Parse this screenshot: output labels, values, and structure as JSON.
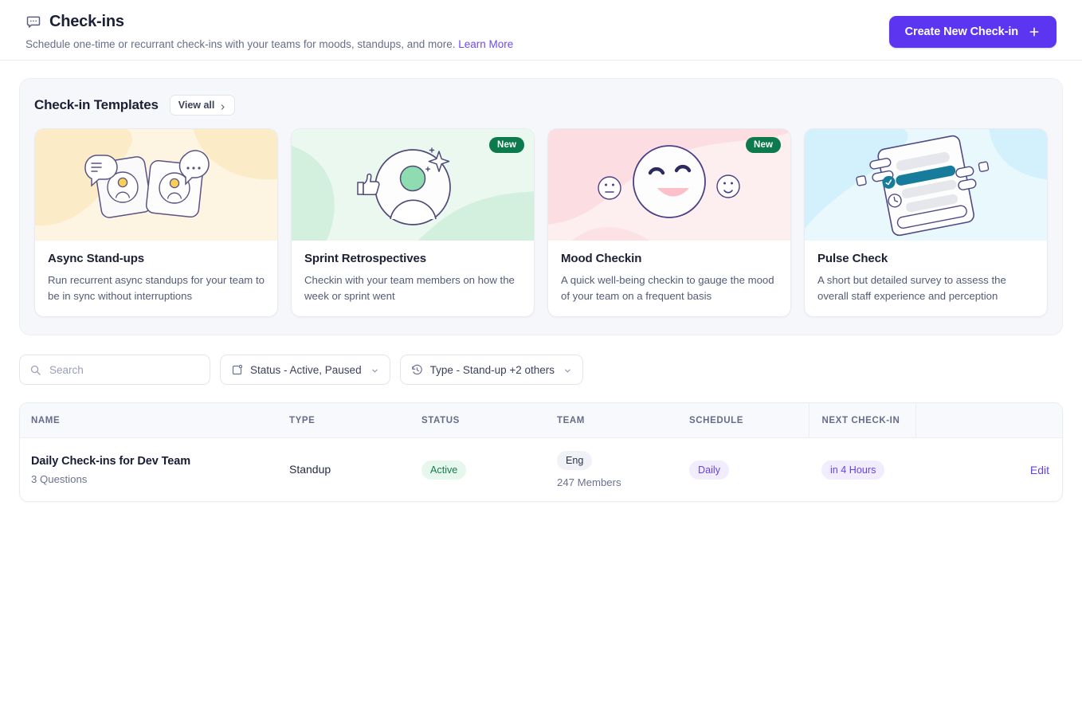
{
  "header": {
    "icon": "message-square-dots-icon",
    "title": "Check-ins",
    "subtitle": "Schedule one-time or recurrant check-ins with your teams for moods, standups, and more.",
    "learn_more": "Learn More",
    "create_button": "Create New Check-in",
    "create_button_icon": "plus-icon",
    "accent_color": "#5b35ef"
  },
  "templates": {
    "section_title": "Check-in Templates",
    "view_all": "View all",
    "view_all_icon": "chevron-right-icon",
    "cards": [
      {
        "title": "Async Stand-ups",
        "description": "Run recurrent async standups for your team to be in sync without interruptions",
        "badge": "",
        "art": "speech-bubbles-people-illustration",
        "bg": "#fdf4e2"
      },
      {
        "title": "Sprint Retrospectives",
        "description": "Checkin with your team members on how the week or sprint went",
        "badge": "New",
        "art": "avatar-thumbs-up-illustration",
        "bg": "#eaf8ef"
      },
      {
        "title": "Mood Checkin",
        "description": "A quick well-being checkin to gauge the mood of your team on a frequent basis",
        "badge": "New",
        "art": "smiley-faces-illustration",
        "bg": "#fdeef0"
      },
      {
        "title": "Pulse Check",
        "description": "A short but detailed survey to assess the overall staff experience and perception",
        "badge": "",
        "art": "survey-document-illustration",
        "bg": "#e8f8fd"
      }
    ],
    "badge_color": "#0c7a4d"
  },
  "filters": {
    "search_placeholder": "Search",
    "search_value": "",
    "search_icon": "search-icon",
    "status": {
      "label": "Status - Active, Paused",
      "icon": "status-square-icon"
    },
    "type": {
      "label": "Type - Stand-up +2 others",
      "icon": "clock-history-icon"
    }
  },
  "table": {
    "columns": [
      "NAME",
      "TYPE",
      "STATUS",
      "TEAM",
      "SCHEDULE",
      "NEXT CHECK-IN",
      ""
    ],
    "rows": [
      {
        "name": "Daily Check-ins for Dev Team",
        "questions": "3 Questions",
        "type": "Standup",
        "status": "Active",
        "team": "Eng",
        "team_members": "247 Members",
        "schedule": "Daily",
        "next_checkin": "in 4 Hours",
        "action": "Edit"
      }
    ]
  }
}
